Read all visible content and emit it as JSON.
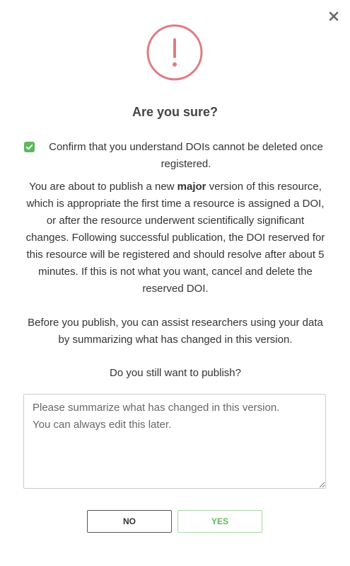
{
  "dialog": {
    "title": "Are you sure?",
    "confirm_checkbox": {
      "checked": true,
      "label": "Confirm that you understand DOIs cannot be deleted once registered."
    },
    "description": {
      "part1_before": "You are about to publish a new ",
      "part1_bold": "major",
      "part1_after": " version of this resource, which is appropriate the first time a resource is assigned a DOI, or after the resource underwent scientifically significant changes. Following successful publication, the DOI reserved for this resource will be registered and should resolve after about 5 minutes. If this is not what you want, cancel and delete the reserved DOI.",
      "part2": "Before you publish, you can assist researchers using your data by summarizing what has changed in this version.",
      "part3": "Do you still want to publish?"
    },
    "summary_field": {
      "value": "",
      "placeholder": "Please summarize what has changed in this version.\nYou can always edit this later."
    },
    "buttons": {
      "no_label": "NO",
      "yes_label": "YES"
    },
    "icons": {
      "close": "close-icon",
      "alert": "exclamation-circle-icon",
      "check": "checkmark-icon"
    },
    "colors": {
      "alert_red": "#e07a84",
      "success_green": "#5cb85c",
      "yes_border": "#a9d7a9"
    }
  }
}
